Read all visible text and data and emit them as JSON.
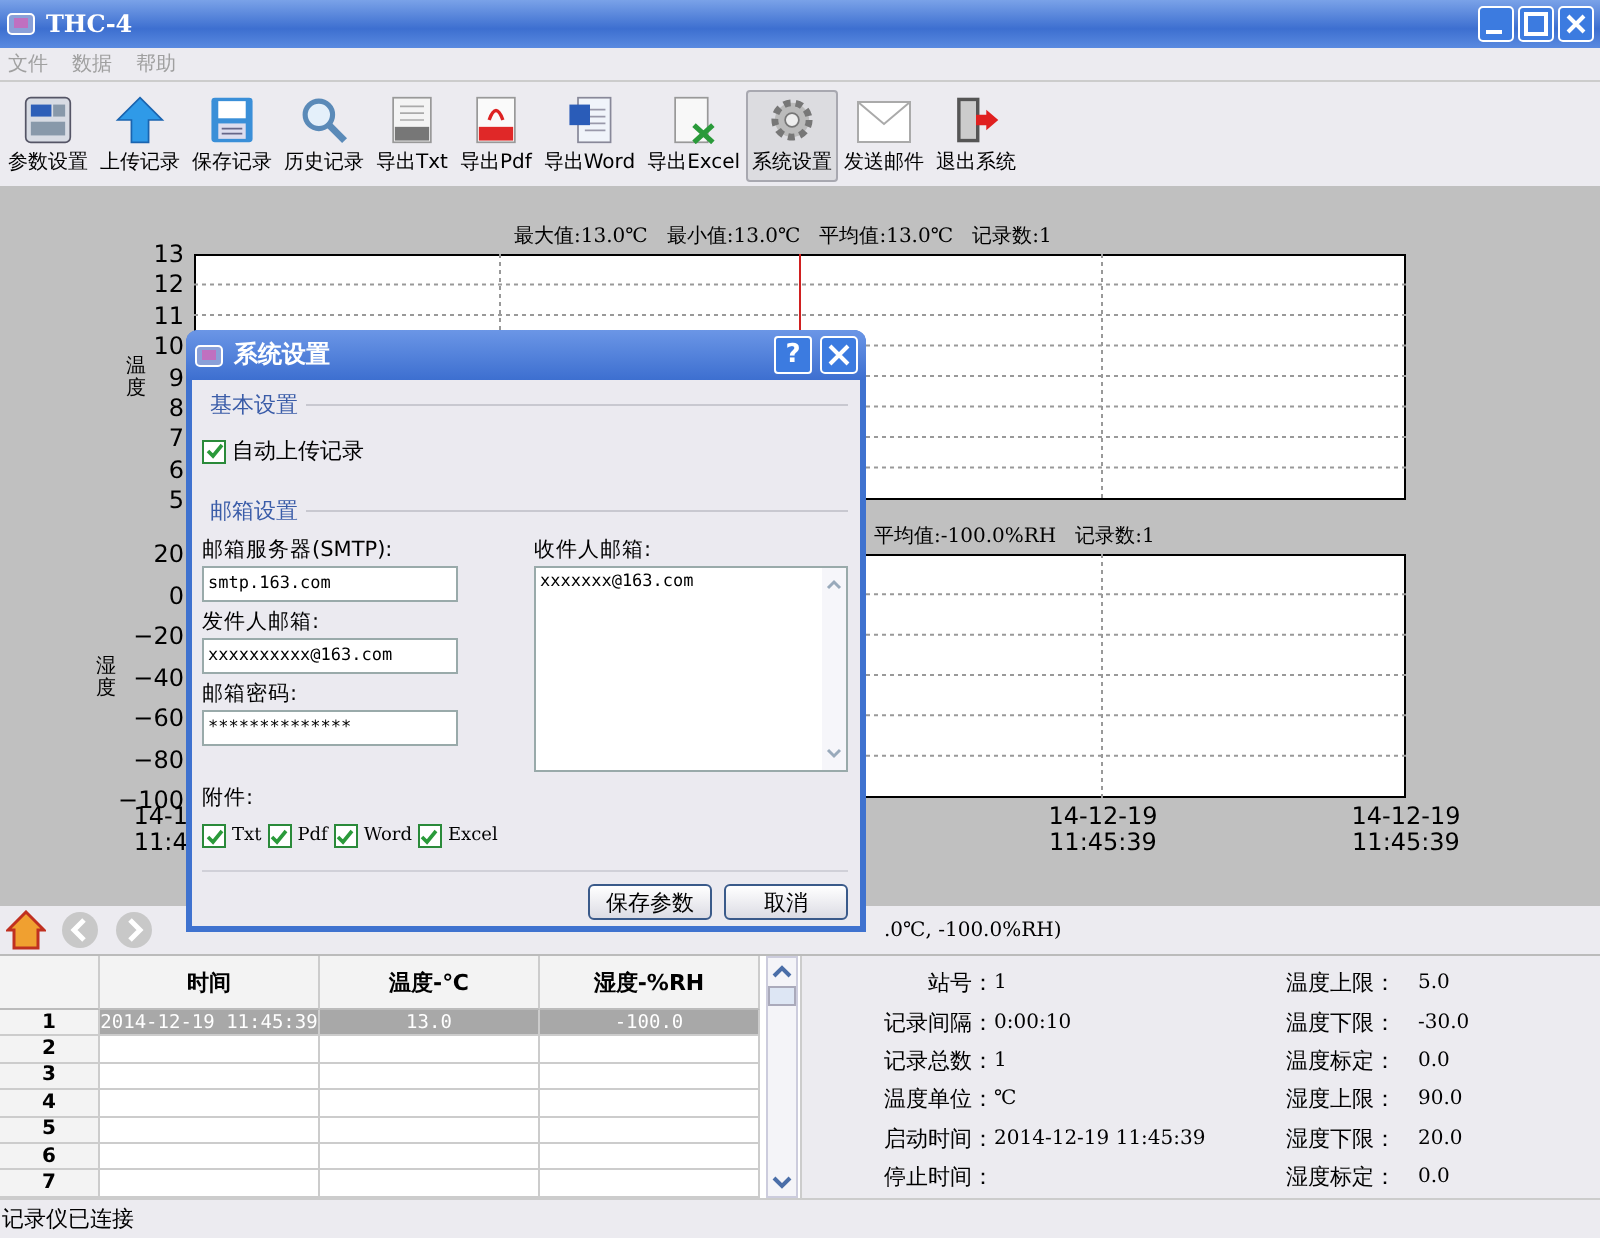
{
  "window": {
    "title": "THC-4"
  },
  "menu": [
    {
      "label": "文件",
      "disabled": true
    },
    {
      "label": "数据",
      "disabled": true
    },
    {
      "label": "帮助",
      "disabled": true
    }
  ],
  "toolbar": [
    {
      "label": "参数设置",
      "kind": "params",
      "selected": false
    },
    {
      "label": "上传记录",
      "kind": "upload",
      "selected": false
    },
    {
      "label": "保存记录",
      "kind": "save",
      "selected": false
    },
    {
      "label": "历史记录",
      "kind": "search",
      "selected": false
    },
    {
      "label": "导出Txt",
      "kind": "txt",
      "selected": false
    },
    {
      "label": "导出Pdf",
      "kind": "pdf",
      "selected": false
    },
    {
      "label": "导出Word",
      "kind": "word",
      "selected": false
    },
    {
      "label": "导出Excel",
      "kind": "excel",
      "selected": false
    },
    {
      "label": "系统设置",
      "kind": "gear",
      "selected": true
    },
    {
      "label": "发送邮件",
      "kind": "mail",
      "selected": false
    },
    {
      "label": "退出系统",
      "kind": "exit",
      "selected": false
    }
  ],
  "temperature_chart": {
    "header": "最大值:13.0℃   最小值:13.0℃   平均值:13.0℃   记录数:1",
    "axis_title": "温度",
    "y_ticks": [
      "13",
      "12",
      "11",
      "10",
      "9",
      "8",
      "7",
      "6",
      "5"
    ]
  },
  "humidity_chart": {
    "header": "平均值:-100.0%RH   记录数:1",
    "axis_title": "湿度",
    "y_ticks": [
      "20",
      "0",
      "−20",
      "−40",
      "−60",
      "−80",
      "−100"
    ],
    "x_ticks": [
      {
        "date": "14-1",
        "time": "11:4"
      },
      {
        "date": "14-12-19",
        "time": "11:45:39"
      },
      {
        "date": "14-12-19",
        "time": "11:45:39"
      }
    ]
  },
  "nav": {
    "reading": ".0℃, -100.0%RH)"
  },
  "table": {
    "columns": [
      "时间",
      "温度-℃",
      "湿度-%RH"
    ],
    "rows": [
      {
        "number": "1",
        "cells": [
          "2014-12-19 11:45:39",
          "13.0",
          "-100.0"
        ],
        "selected": true
      },
      {
        "number": "2",
        "selected": false
      },
      {
        "number": "3",
        "selected": false
      },
      {
        "number": "4",
        "selected": false
      },
      {
        "number": "5",
        "selected": false
      },
      {
        "number": "6",
        "selected": false
      },
      {
        "number": "7",
        "selected": false
      }
    ]
  },
  "info": {
    "left": [
      {
        "label": "站号：",
        "value": "1"
      },
      {
        "label": "记录间隔：",
        "value": "0:00:10"
      },
      {
        "label": "记录总数：",
        "value": "1"
      },
      {
        "label": "温度单位：",
        "value": "℃"
      },
      {
        "label": "启动时间：",
        "value": "2014-12-19 11:45:39"
      },
      {
        "label": "停止时间："
      }
    ],
    "right": [
      {
        "label": "温度上限：",
        "value": "5.0"
      },
      {
        "label": "温度下限：",
        "value": "-30.0"
      },
      {
        "label": "温度标定：",
        "value": "0.0"
      },
      {
        "label": "湿度上限：",
        "value": "90.0"
      },
      {
        "label": "湿度下限：",
        "value": "20.0"
      },
      {
        "label": "湿度标定：",
        "value": "0.0"
      }
    ]
  },
  "status_bar": "记录仪已连接",
  "dialog": {
    "title": "系统设置",
    "help_button": "?",
    "basic_group": "基本设置",
    "auto_upload": {
      "label": "自动上传记录",
      "checked": true
    },
    "mail_group": "邮箱设置",
    "smtp": {
      "label": "邮箱服务器(SMTP):",
      "value": "smtp.163.com"
    },
    "sender": {
      "label": "发件人邮箱:",
      "value": "xxxxxxxxxx@163.com"
    },
    "password": {
      "label": "邮箱密码:",
      "value": "**************"
    },
    "recipients": {
      "label": "收件人邮箱:",
      "value": "xxxxxxx@163.com"
    },
    "attachments_label": "附件:",
    "attachments": [
      {
        "label": "Txt",
        "checked": true
      },
      {
        "label": "Pdf",
        "checked": true
      },
      {
        "label": "Word",
        "checked": true
      },
      {
        "label": "Excel",
        "checked": true
      }
    ],
    "buttons": [
      "保存参数",
      "取消"
    ]
  }
}
